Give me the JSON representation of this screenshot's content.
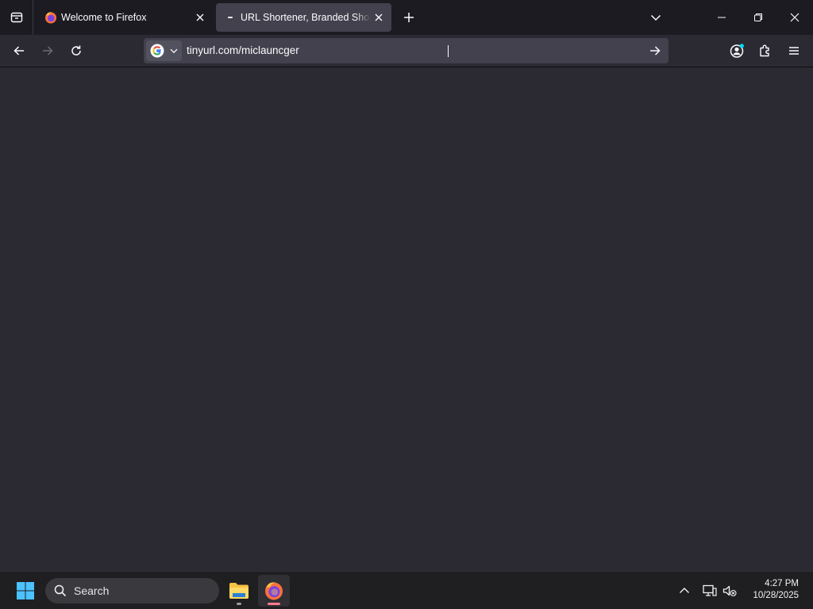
{
  "tabs": [
    {
      "title": "Welcome to Firefox",
      "active": false
    },
    {
      "title": "URL Shortener, Branded Short Links & Analytics | TinyURL",
      "active": true
    }
  ],
  "urlbar": {
    "value": "tinyurl.com/miclauncger",
    "search_engine": "google-icon"
  },
  "taskbar": {
    "search_label": "Search",
    "time": "4:27 PM",
    "date": "10/28/2025"
  },
  "colors": {
    "tab_strip": "#1c1b22",
    "toolbar": "#2b2a33",
    "urlbar": "#42414d",
    "active_tab": "#42414d",
    "taskbar": "#1f1f22",
    "accent_blue": "#00ddff"
  }
}
